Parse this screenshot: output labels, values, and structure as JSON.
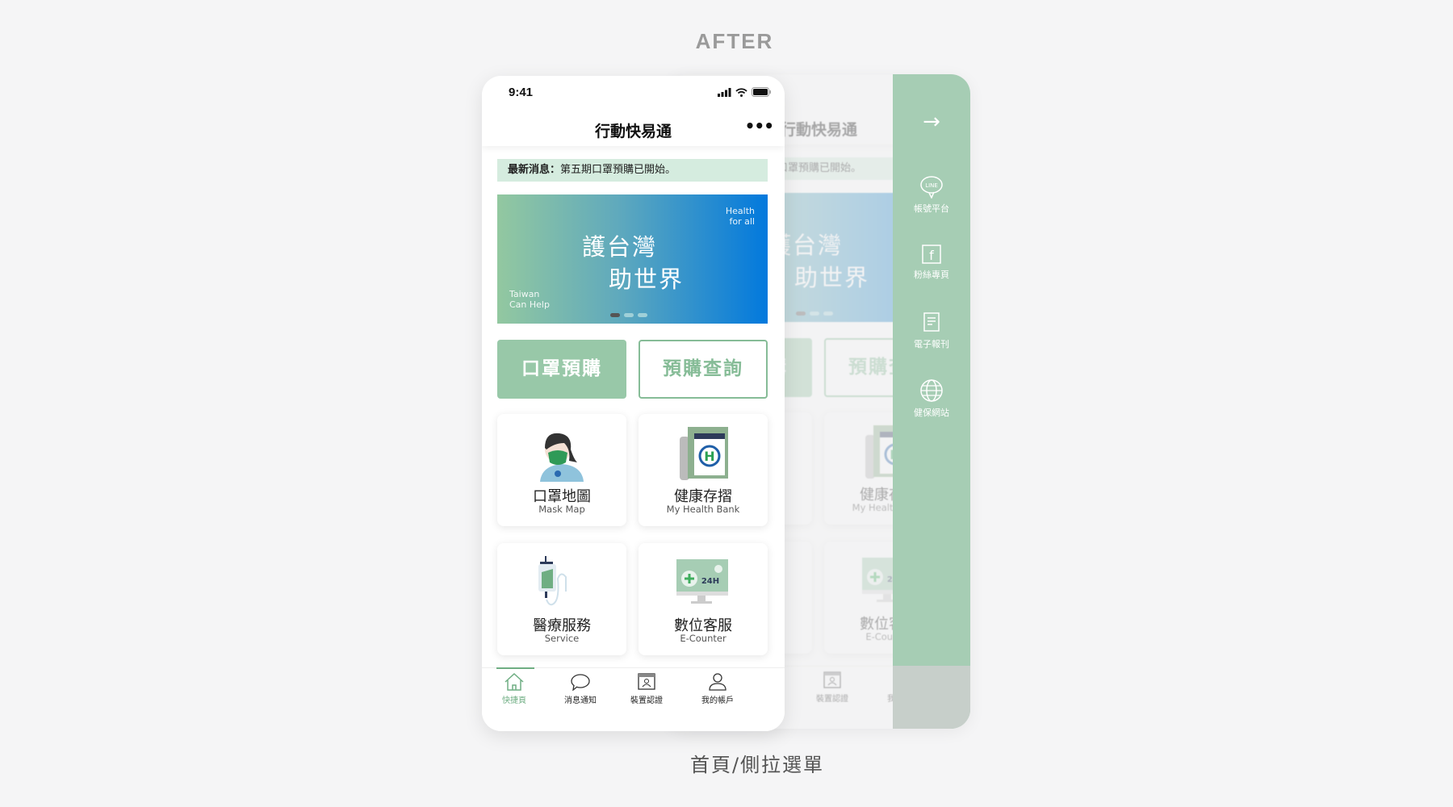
{
  "heading": "AFTER",
  "caption": "首頁/側拉選單",
  "status": {
    "time": "9:41"
  },
  "header": {
    "title": "行動快易通",
    "more": "•••"
  },
  "news": {
    "label": "最新消息",
    "separator": "：",
    "text": "第五期口罩預購已開始。"
  },
  "banner": {
    "line1": "護台灣",
    "line2": "助世界",
    "health1": "Health",
    "health2": "for all",
    "taiwan1": "Taiwan",
    "taiwan2": "Can Help",
    "slides": 3,
    "active_slide": 1
  },
  "actions": {
    "primary": "口罩預購",
    "secondary": "預購查詢"
  },
  "cards": [
    {
      "zh": "口罩地圖",
      "en": "Mask Map",
      "icon": "mask-person-icon"
    },
    {
      "zh": "健康存摺",
      "en": "My Health Bank",
      "icon": "health-bank-book-icon"
    },
    {
      "zh": "醫療服務",
      "en": "Service",
      "icon": "iv-drip-icon"
    },
    {
      "zh": "數位客服",
      "en": "E-Counter",
      "icon": "monitor-24h-icon"
    }
  ],
  "tabs": [
    {
      "label": "快捷頁",
      "icon": "home-icon",
      "active": true
    },
    {
      "label": "消息通知",
      "icon": "chat-bubble-icon"
    },
    {
      "label": "裝置認證",
      "icon": "id-card-icon"
    },
    {
      "label": "我的帳戶",
      "icon": "user-icon"
    }
  ],
  "sidebar": {
    "close": "→",
    "items": [
      {
        "label": "帳號平台",
        "icon": "line-icon",
        "icon_text": "LINE"
      },
      {
        "label": "粉絲專頁",
        "icon": "facebook-icon",
        "icon_text": "f"
      },
      {
        "label": "電子報刊",
        "icon": "newsletter-icon"
      },
      {
        "label": "健保網站",
        "icon": "globe-icon"
      }
    ]
  },
  "colors": {
    "accent": "#98c8a8",
    "sidebar": "#a6cdb4",
    "news_bg": "#d5ecdf",
    "banner_start": "#93c8a0",
    "banner_end": "#0279dd"
  }
}
